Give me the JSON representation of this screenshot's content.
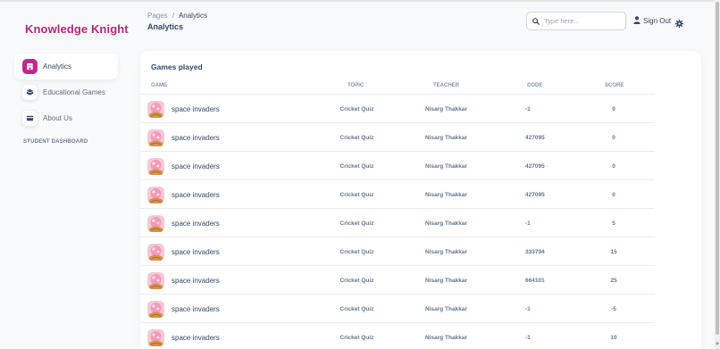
{
  "brand": "Knowledge Knight",
  "sidebar": {
    "items": [
      {
        "label": "Analytics",
        "icon": "shop-icon",
        "active": true
      },
      {
        "label": "Educational Games",
        "icon": "cube-icon",
        "active": false
      },
      {
        "label": "About Us",
        "icon": "card-icon",
        "active": false
      }
    ],
    "section_title": "STUDENT DASHBOARD"
  },
  "header": {
    "breadcrumb_root": "Pages",
    "breadcrumb_sep": "/",
    "breadcrumb_current": "Analytics",
    "page_title": "Analytics",
    "search_placeholder": "Type here...",
    "signout_label": "Sign Out"
  },
  "table": {
    "title": "Games played",
    "columns": [
      "GAME",
      "TOPIC",
      "TEACHER",
      "CODE",
      "SCORE"
    ],
    "rows": [
      {
        "game": "space invaders",
        "topic": "Cricket Quiz",
        "teacher": "Nisarg Thakkar",
        "code": "-1",
        "score": "0"
      },
      {
        "game": "space invaders",
        "topic": "Cricket Quiz",
        "teacher": "Nisarg Thakkar",
        "code": "427095",
        "score": "0"
      },
      {
        "game": "space invaders",
        "topic": "Cricket Quiz",
        "teacher": "Nisarg Thakkar",
        "code": "427095",
        "score": "0"
      },
      {
        "game": "space invaders",
        "topic": "Cricket Quiz",
        "teacher": "Nisarg Thakkar",
        "code": "427095",
        "score": "0"
      },
      {
        "game": "space invaders",
        "topic": "Cricket Quiz",
        "teacher": "Nisarg Thakkar",
        "code": "-1",
        "score": "5"
      },
      {
        "game": "space invaders",
        "topic": "Cricket Quiz",
        "teacher": "Nisarg Thakkar",
        "code": "333794",
        "score": "15"
      },
      {
        "game": "space invaders",
        "topic": "Cricket Quiz",
        "teacher": "Nisarg Thakkar",
        "code": "664101",
        "score": "25"
      },
      {
        "game": "space invaders",
        "topic": "Cricket Quiz",
        "teacher": "Nisarg Thakkar",
        "code": "-1",
        "score": "-5"
      },
      {
        "game": "space invaders",
        "topic": "Cricket Quiz",
        "teacher": "Nisarg Thakkar",
        "code": "-1",
        "score": "10"
      }
    ]
  },
  "colors": {
    "brand": "#b0297a",
    "accent": "#c2278f",
    "text": "#344767",
    "muted": "#67748e"
  }
}
